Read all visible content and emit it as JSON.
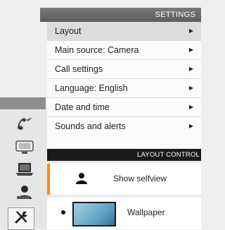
{
  "settings": {
    "title": "SETTINGS",
    "items": [
      {
        "label": "Layout",
        "selected": true
      },
      {
        "label": "Main source: Camera"
      },
      {
        "label": "Call settings"
      },
      {
        "label": "Language: English"
      },
      {
        "label": "Date and time"
      },
      {
        "label": "Sounds and alerts"
      }
    ]
  },
  "layout_control": {
    "title": "LAYOUT CONTROL",
    "options": [
      {
        "label": "Show selfview",
        "icon": "person-icon"
      },
      {
        "label": "Wallpaper",
        "icon": "wallpaper-thumbnail",
        "radio": true
      }
    ]
  },
  "sidebar": {
    "items": [
      {
        "icon": "handset-icon"
      },
      {
        "icon": "presentation-screen-icon"
      },
      {
        "icon": "laptop-icon"
      },
      {
        "icon": "contacts-person-icon"
      },
      {
        "icon": "tools-icon",
        "active": true
      }
    ]
  },
  "colors": {
    "accent": "#ff8a00",
    "header": "#666666",
    "dark_header": "#1b1b1b"
  }
}
